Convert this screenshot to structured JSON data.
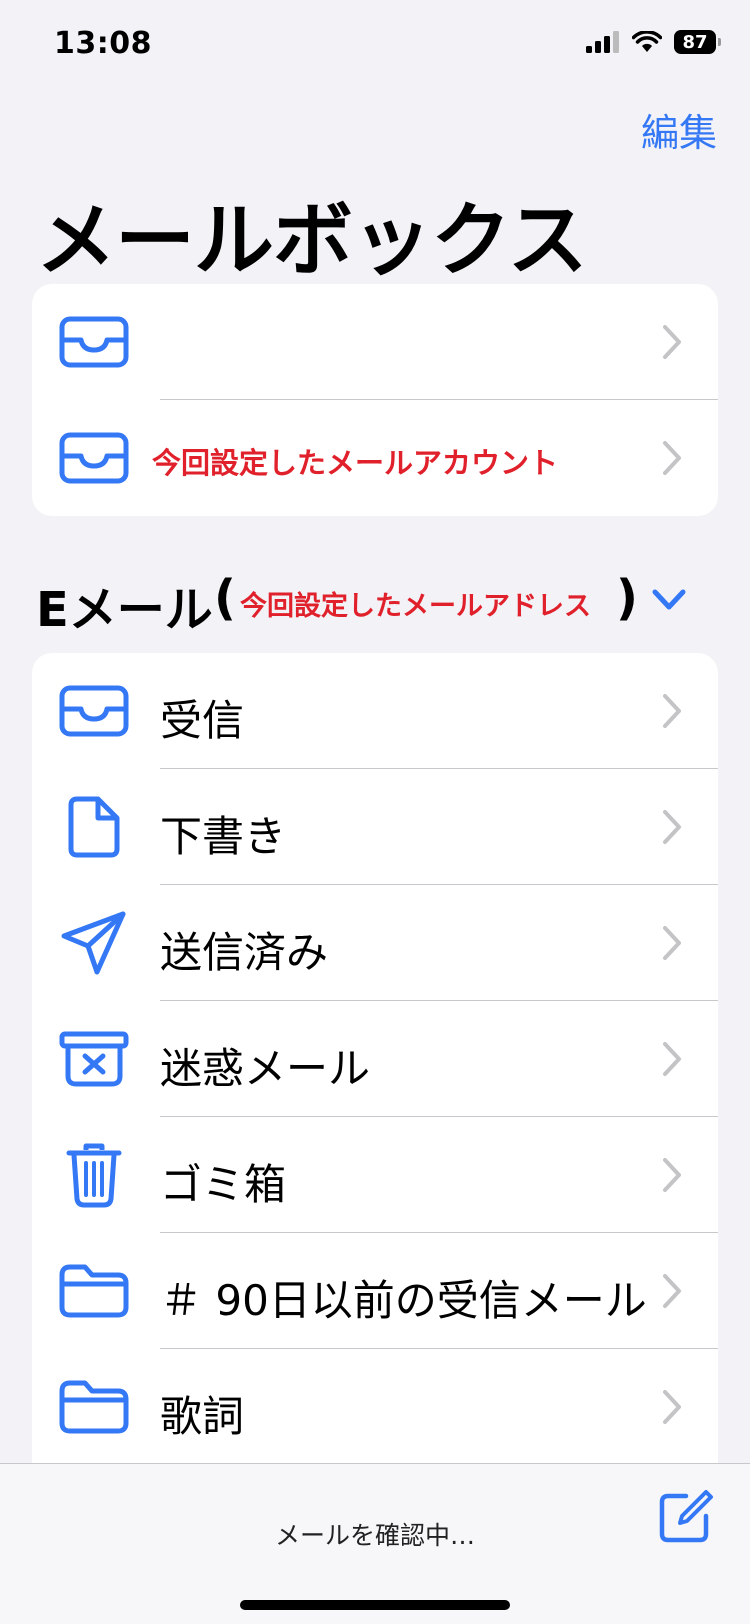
{
  "status_bar": {
    "time": "13:08",
    "battery": "87"
  },
  "nav": {
    "edit_label": "編集",
    "title": "メールボックス"
  },
  "top_mailboxes": [
    {
      "label": "",
      "icon": "inbox-tray-icon"
    },
    {
      "label": "今回設定したメールアカウント",
      "icon": "inbox-tray-icon"
    }
  ],
  "section": {
    "title": "Eメール",
    "paren_open": "(",
    "annotation": "今回設定したメールアドレス",
    "paren_close": ")"
  },
  "folders": [
    {
      "label": "受信",
      "icon": "inbox-tray-icon"
    },
    {
      "label": "下書き",
      "icon": "document-icon"
    },
    {
      "label": "送信済み",
      "icon": "paper-plane-icon"
    },
    {
      "label": "迷惑メール",
      "icon": "junk-box-icon"
    },
    {
      "label": "ゴミ箱",
      "icon": "trash-icon"
    },
    {
      "label": "＃ 90日以前の受信メール",
      "icon": "folder-icon"
    },
    {
      "label": "歌詞",
      "icon": "folder-icon"
    }
  ],
  "toolbar": {
    "status_text": "メールを確認中…"
  },
  "colors": {
    "accent": "#3478f6",
    "annotation_red": "#e0202a",
    "background": "#f2f2f7"
  }
}
